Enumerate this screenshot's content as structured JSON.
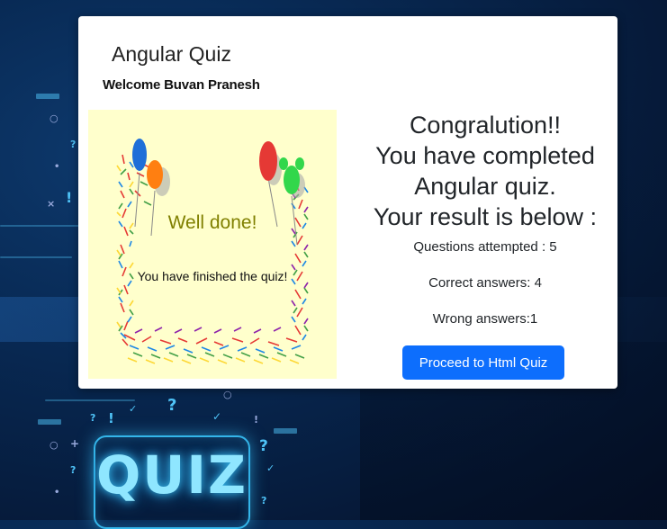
{
  "quiz_app": {
    "title": "Angular Quiz",
    "welcome_text": "Welcome Buvan Pranesh"
  },
  "illustration": {
    "heading": "Well done!",
    "message": "You have finished the quiz!"
  },
  "result": {
    "headline_lines": [
      "Congralution!!",
      "You have completed",
      "Angular quiz.",
      "Your result is below :"
    ],
    "questions_attempted": "Questions attempted : 5",
    "correct_answers": "Correct answers: 4",
    "wrong_answers": "Wrong answers:1",
    "proceed_button_label": "Proceed to Html Quiz"
  },
  "background": {
    "sign_text": "QUIZ"
  },
  "colors": {
    "primary_button": "#0d6efd",
    "illustration_bg": "#ffffcc",
    "well_done_text": "#808000",
    "sign_glow": "#35b6ea"
  }
}
